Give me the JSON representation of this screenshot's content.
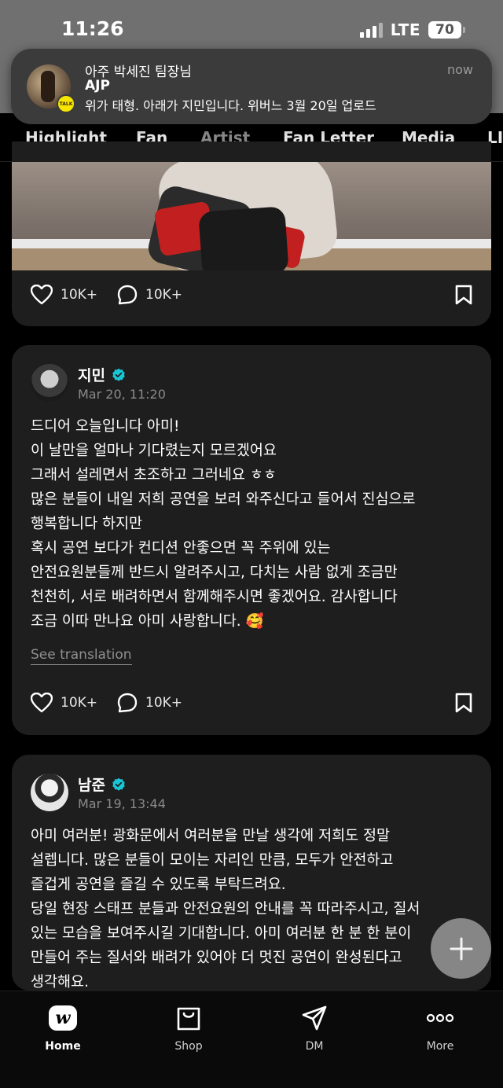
{
  "status_bar": {
    "time": "11:26",
    "network": "LTE",
    "battery": "70"
  },
  "notification": {
    "title": "아주 박세진 팀장님",
    "sender": "AJP",
    "message": "위가 태형. 아래가 지민입니다. 위버느 3월 20일 업로드",
    "time": "now",
    "app_badge": "TALK"
  },
  "tabs": [
    {
      "label": "Highlight"
    },
    {
      "label": "Fan"
    },
    {
      "label": "Artist"
    },
    {
      "label": "Fan Letter"
    },
    {
      "label": "Media"
    },
    {
      "label": "LI"
    }
  ],
  "active_tab": "Artist",
  "posts": [
    {
      "likes": "10K+",
      "comments": "10K+"
    },
    {
      "author": "지민",
      "date": "Mar 20, 11:20",
      "lines": [
        "드디어 오늘입니다 아미!",
        "이 날만을 얼마나 기다렸는지 모르겠어요",
        "그래서 설레면서 초조하고 그러네요 ㅎㅎ",
        "많은 분들이 내일 저희 공연을 보러 와주신다고 들어서 진심으로",
        "행복합니다 하지만",
        "혹시 공연 보다가 컨디션 안좋으면 꼭 주위에 있는",
        "안전요원분들께 반드시 알려주시고, 다치는 사람 없게 조금만",
        "천천히, 서로 배려하면서 함께해주시면 좋겠어요. 감사합니다",
        "조금 이따 만나요 아미 사랑합니다. 🥰"
      ],
      "see_translation": "See translation",
      "likes": "10K+",
      "comments": "10K+"
    },
    {
      "author": "남준",
      "date": "Mar 19, 13:44",
      "lines": [
        "아미 여러분! 광화문에서 여러분을 만날 생각에 저희도 정말",
        "설렙니다. 많은 분들이 모이는 자리인 만큼, 모두가 안전하고",
        "즐겁게 공연을 즐길 수 있도록 부탁드려요.",
        "당일 현장 스태프 분들과 안전요원의 안내를 꼭 따라주시고, 질서",
        "있는 모습을 보여주시길 기대합니다. 아미 여러분 한 분 한 분이",
        "만들어 주는 질서와 배려가 있어야 더 멋진 공연이 완성된다고",
        "생각해요."
      ]
    }
  ],
  "bottom_nav": [
    {
      "label": "Home",
      "icon": "weverse-home-icon"
    },
    {
      "label": "Shop",
      "icon": "shopping-bag-icon"
    },
    {
      "label": "DM",
      "icon": "paper-plane-icon"
    },
    {
      "label": "More",
      "icon": "more-dots-icon"
    }
  ],
  "colors": {
    "verified": "#17c7d6",
    "card_bg": "#1e1e1e",
    "muted_text": "#8a8a8a"
  }
}
